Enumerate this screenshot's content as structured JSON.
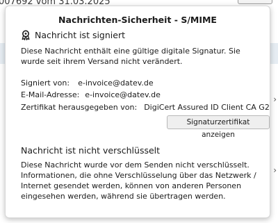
{
  "background": {
    "header_text": "007692 vom 31.03.2025"
  },
  "popup": {
    "title": "Nachrichten-Sicherheit - S/MIME",
    "signature": {
      "heading": "Nachricht ist signiert",
      "description": "Diese Nachricht enthält eine gültige digitale Signatur. Sie wurde seit ihrem Versand nicht verändert.",
      "signed_by_label": "Signiert von:",
      "signed_by_value": "e-invoice@datev.de",
      "email_label": "E-Mail-Adresse:",
      "email_value": "e-invoice@datev.de",
      "issuer_label": "Zertifikat herausgegeben von:",
      "issuer_value": "DigiCert Assured ID Client CA G2",
      "view_cert_button": "Signaturzertifikat anzeigen"
    },
    "encryption": {
      "heading": "Nachricht ist nicht verschlüsselt",
      "description": "Diese Nachricht wurde vor dem Senden nicht verschlüsselt. Informationen, die ohne Verschlüsselung über das Netzwerk / Internet gesendet werden, können von anderen Personen eingesehen werden, während sie übertragen werden."
    },
    "icons": {
      "signature": "award-ribbon-icon"
    }
  }
}
